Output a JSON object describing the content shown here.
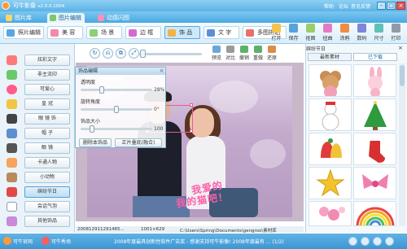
{
  "window": {
    "title": "可牛影像",
    "version": "v2.0.0.1004",
    "links": [
      "帮助",
      "论坛",
      "意见反馈"
    ],
    "buttons": [
      "-",
      "□",
      "×"
    ]
  },
  "top_tabs": [
    {
      "label": "图片库",
      "active": false
    },
    {
      "label": "图片编辑",
      "active": true
    },
    {
      "label": "动感闪图",
      "active": false
    }
  ],
  "module_tabs": [
    {
      "label": "照片编辑",
      "active": false
    },
    {
      "label": "美 容",
      "active": false
    },
    {
      "label": "场 景",
      "active": false
    },
    {
      "label": "边 框",
      "active": false
    },
    {
      "label": "饰 品",
      "active": true
    },
    {
      "label": "文 字",
      "active": false
    },
    {
      "label": "多图拼贴",
      "active": false
    }
  ],
  "right_tools": [
    "打开",
    "保存",
    "抠图",
    "扭曲",
    "涂鸦",
    "数码",
    "尺寸",
    "打印"
  ],
  "left_panel": [
    {
      "label": "炫彩文字",
      "active": false
    },
    {
      "label": "非主流印",
      "active": false
    },
    {
      "label": "可爱心",
      "active": false
    },
    {
      "label": "皇 冠",
      "active": false
    },
    {
      "label": "眼 镜 饰",
      "active": false
    },
    {
      "label": "帽 子",
      "active": false
    },
    {
      "label": "眼 镜",
      "active": false
    },
    {
      "label": "卡通人物",
      "active": false
    },
    {
      "label": "小动物",
      "active": false
    },
    {
      "label": "缤纷节日",
      "active": true
    },
    {
      "label": "会话气泡",
      "active": false
    },
    {
      "label": "其他饰品",
      "active": false
    }
  ],
  "canvas_toolbar": {
    "buttons": [
      "↻",
      "⎌",
      "⧉",
      "⤢"
    ],
    "actions": [
      "预览",
      "对比",
      "撤销",
      "重做",
      "还原"
    ]
  },
  "adjust_panel": {
    "title": "饰品编辑",
    "close": "×",
    "sliders": [
      {
        "label": "透明度",
        "value": "28%",
        "fraction": 0.28
      },
      {
        "label": "旋转角度",
        "value": "0°",
        "fraction": 0.5
      },
      {
        "label": "饰品大小",
        "value": "100",
        "fraction": 0.14
      }
    ],
    "buttons": [
      "删除本饰品",
      "正片叠底(融合)"
    ]
  },
  "overlay_texts": [
    "我爱的",
    "我的猫吧！"
  ],
  "right_panel": {
    "title": "缤纷节日",
    "close": "×",
    "tabs": [
      {
        "label": "最新素材",
        "active": false
      },
      {
        "label": "已下载",
        "active": true
      }
    ],
    "thumbnails": [
      "teddy-bear",
      "pink-bunny",
      "snowman",
      "christmas-tree",
      "christmas-bells",
      "christmas-stocking",
      "star-wreath",
      "pink-ribbon",
      "pink-hearts",
      "rainbow"
    ]
  },
  "statusline": {
    "filename": "200812911291465...",
    "size": "1001×629",
    "path": "C:\\Users\\Spring\\Documents\\gengroo\\素材库"
  },
  "bottom_bar": {
    "left_items": [
      "可牛官网",
      "可牛秀场"
    ],
    "message": "2008年度最具创新性软件广告奖 - 感谢支持可牛影像! 2008年度最有 ... (1/2)"
  },
  "colors": {
    "accent": "#4aa9e2",
    "active_tab": "#cde8fb",
    "overlay_text": "#ff5ea8"
  }
}
